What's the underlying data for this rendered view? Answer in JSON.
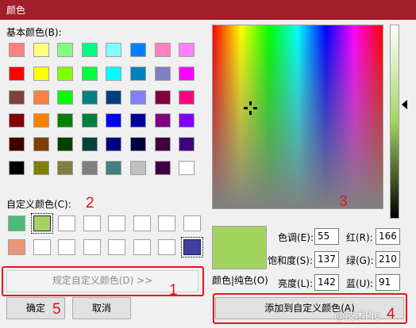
{
  "window": {
    "title": "颜色"
  },
  "basic_colors": {
    "label": "基本颜色(B):",
    "rows": [
      [
        "#ff8080",
        "#ffff80",
        "#80ff80",
        "#00ff80",
        "#80ffff",
        "#0080ff",
        "#ff80c0",
        "#ff80ff"
      ],
      [
        "#ff0000",
        "#ffff00",
        "#80ff00",
        "#00ff40",
        "#00ffff",
        "#0080c0",
        "#8080c0",
        "#ff00ff"
      ],
      [
        "#804040",
        "#ff8040",
        "#00ff00",
        "#008080",
        "#004080",
        "#8080ff",
        "#800040",
        "#ff0080"
      ],
      [
        "#800000",
        "#ff8000",
        "#008000",
        "#008040",
        "#0000ff",
        "#0000a0",
        "#800080",
        "#8000ff"
      ],
      [
        "#400000",
        "#804000",
        "#004000",
        "#004040",
        "#000080",
        "#000040",
        "#400040",
        "#400080"
      ],
      [
        "#000000",
        "#808000",
        "#808040",
        "#808080",
        "#408080",
        "#c0c0c0",
        "#400040",
        "#ffffff"
      ]
    ]
  },
  "custom_colors": {
    "label": "自定义颜色(C):",
    "rows": [
      [
        "#4cba78",
        "#a3d360",
        "#ffffff",
        "#ffffff",
        "#ffffff",
        "#ffffff",
        "#ffffff",
        "#ffffff"
      ],
      [
        "#e8967a",
        "#ffffff",
        "#ffffff",
        "#ffffff",
        "#ffffff",
        "#ffffff",
        "#ffffff",
        "#4040a0"
      ]
    ]
  },
  "buttons": {
    "define_custom": "规定自定义颜色(D) >>",
    "ok": "确定",
    "cancel": "取消",
    "add_custom": "添加到自定义颜色(A)"
  },
  "preview": {
    "label": "颜色|纯色(O)",
    "color": "#a3d460"
  },
  "fields": {
    "hue": {
      "label": "色调(E):",
      "value": "55"
    },
    "sat": {
      "label": "饱和度(S):",
      "value": "137"
    },
    "lum": {
      "label": "亮度(L):",
      "value": "142"
    },
    "red": {
      "label": "红(R):",
      "value": "166"
    },
    "green": {
      "label": "绿(G):",
      "value": "210"
    },
    "blue": {
      "label": "蓝(U):",
      "value": "91"
    }
  },
  "annotations": {
    "a1": "1",
    "a2": "2",
    "a3": "3",
    "a4": "4",
    "a5": "5"
  },
  "watermark": "@技术Pie"
}
